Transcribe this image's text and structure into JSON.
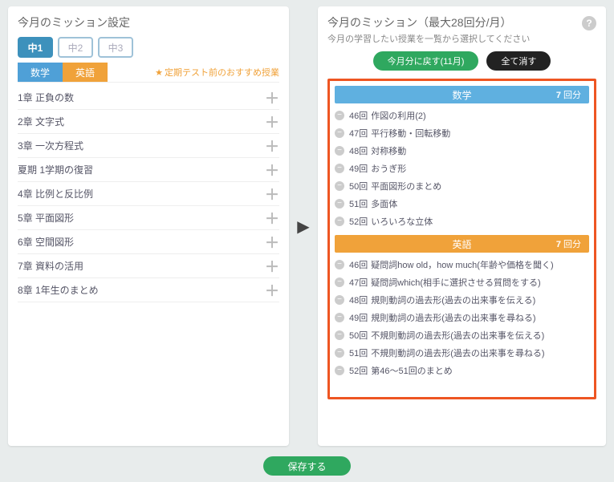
{
  "left": {
    "title": "今月のミッション設定",
    "grades": [
      {
        "label": "中1",
        "active": true
      },
      {
        "label": "中2",
        "active": false
      },
      {
        "label": "中3",
        "active": false
      }
    ],
    "subjects": {
      "math": "数学",
      "english": "英語"
    },
    "recommend": "定期テスト前のおすすめ授業",
    "chapters": [
      "1章 正負の数",
      "2章 文字式",
      "3章 一次方程式",
      "夏期 1学期の復習",
      "4章 比例と反比例",
      "5章 平面図形",
      "6章 空間図形",
      "7章 資料の活用",
      "8章 1年生のまとめ"
    ]
  },
  "right": {
    "title": "今月のミッション（最大28回分/月）",
    "subdesc": "今月の学習したい授業を一覧から選択してください",
    "btn_reset": "今月分に戻す(11月)",
    "btn_clear": "全て消す",
    "math": {
      "label": "数学",
      "count_n": "7",
      "count_u": " 回分",
      "lessons": [
        {
          "num": "46回",
          "name": "作図の利用(2)"
        },
        {
          "num": "47回",
          "name": "平行移動・回転移動"
        },
        {
          "num": "48回",
          "name": "対称移動"
        },
        {
          "num": "49回",
          "name": "おうぎ形"
        },
        {
          "num": "50回",
          "name": "平面図形のまとめ"
        },
        {
          "num": "51回",
          "name": "多面体"
        },
        {
          "num": "52回",
          "name": "いろいろな立体"
        }
      ]
    },
    "english": {
      "label": "英語",
      "count_n": "7",
      "count_u": " 回分",
      "lessons": [
        {
          "num": "46回",
          "name": "疑問詞how old，how much(年齢や価格を聞く)"
        },
        {
          "num": "47回",
          "name": "疑問詞which(相手に選択させる質問をする)"
        },
        {
          "num": "48回",
          "name": "規則動詞の過去形(過去の出来事を伝える)"
        },
        {
          "num": "49回",
          "name": "規則動詞の過去形(過去の出来事を尋ねる)"
        },
        {
          "num": "50回",
          "name": "不規則動詞の過去形(過去の出来事を伝える)"
        },
        {
          "num": "51回",
          "name": "不規則動詞の過去形(過去の出来事を尋ねる)"
        },
        {
          "num": "52回",
          "name": "第46〜51回のまとめ"
        }
      ]
    }
  },
  "save": "保存する"
}
